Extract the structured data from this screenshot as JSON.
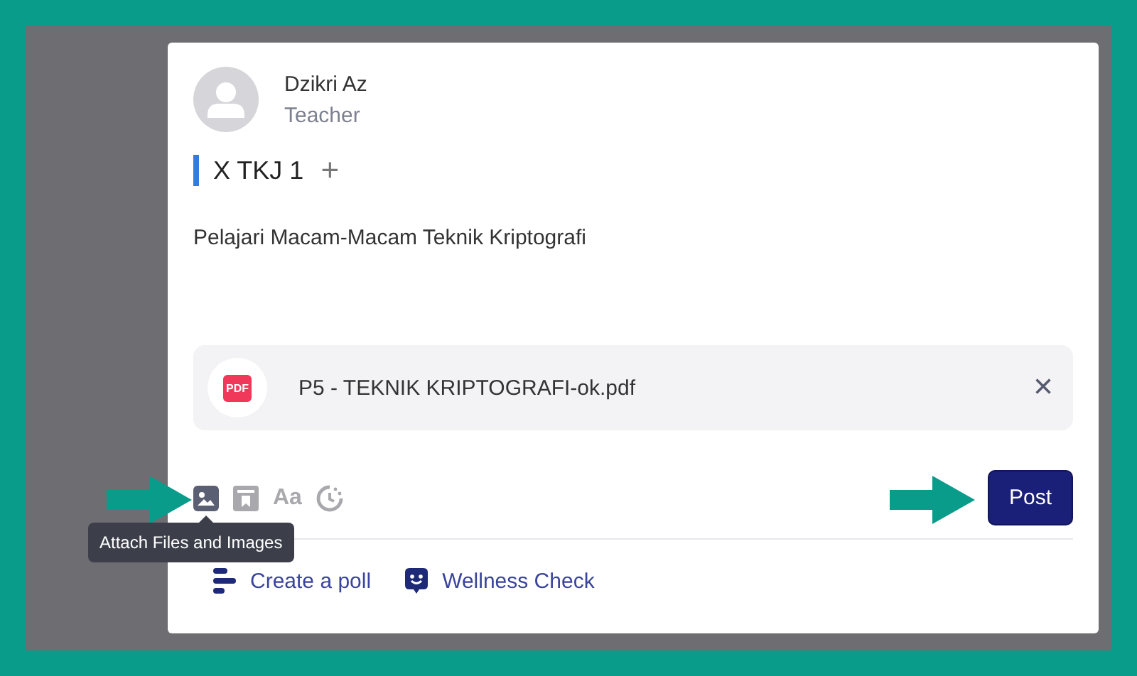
{
  "author": {
    "name": "Dzikri Az",
    "role": "Teacher"
  },
  "class_tag": {
    "label": "X TKJ 1",
    "add": "+"
  },
  "body": "Pelajari Macam-Macam Teknik Kriptografi",
  "attachment": {
    "type_label": "PDF",
    "filename": "P5 - TEKNIK KRIPTOGRAFI-ok.pdf",
    "remove": "×"
  },
  "toolbar": [
    {
      "kind": "image",
      "selected": true
    },
    {
      "kind": "bookmark",
      "selected": false
    },
    {
      "kind": "text",
      "label": "Aa",
      "selected": false
    },
    {
      "kind": "clock",
      "selected": false
    }
  ],
  "tooltip": "Attach Files and Images",
  "post_button": "Post",
  "actions": [
    {
      "kind": "poll",
      "label": "Create a poll"
    },
    {
      "kind": "wellness",
      "label": "Wellness Check"
    }
  ]
}
